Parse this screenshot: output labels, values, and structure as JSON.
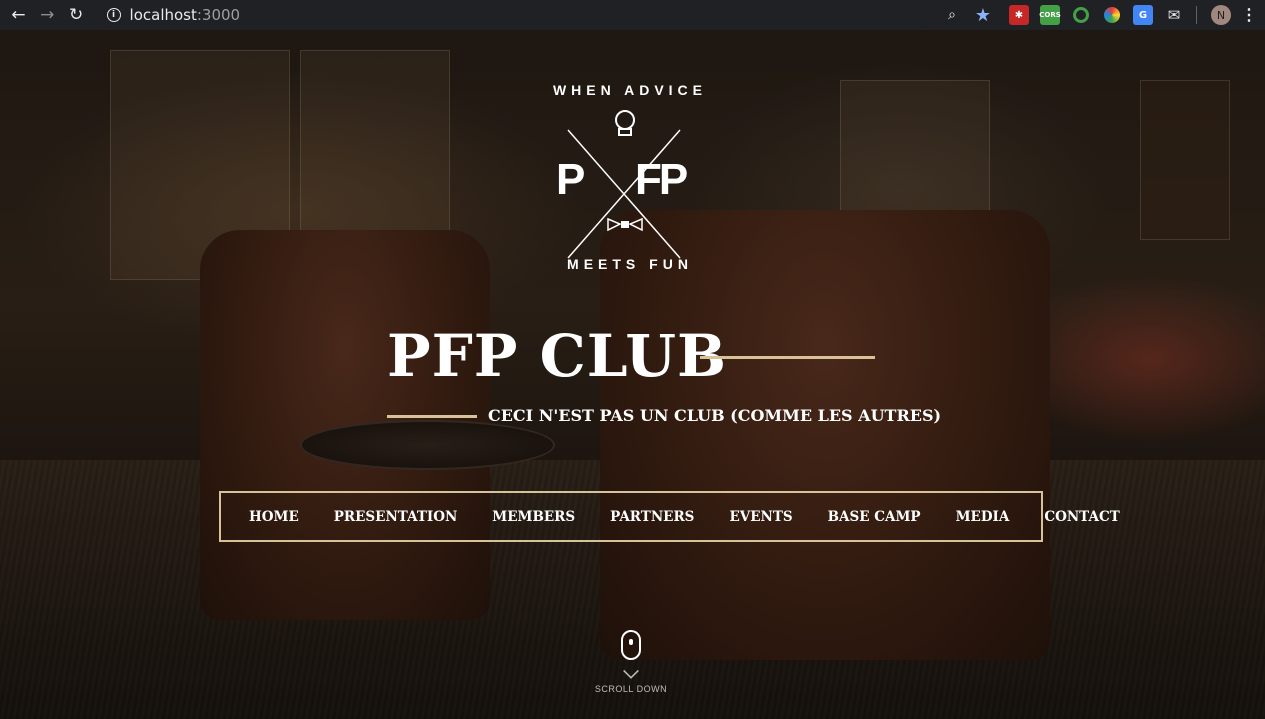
{
  "browser": {
    "url_host": "localhost",
    "url_port": ":3000",
    "avatar_initial": "N",
    "icons": [
      "back-icon",
      "forward-icon",
      "reload-icon",
      "info-icon",
      "zoom-icon",
      "star-icon",
      "menu-icon"
    ],
    "extensions": [
      "ext-red-icon",
      "ext-cors-icon",
      "ext-green-ring-icon",
      "ext-color-icon",
      "ext-translate-icon",
      "ext-mail-icon"
    ],
    "ext_cors_label": "CORS"
  },
  "logo": {
    "top_text": "WHEN ADVICE",
    "bottom_text": "MEETS FUN",
    "monogram_left": "P",
    "monogram_right": "FP"
  },
  "hero": {
    "title": "PFP CLUB",
    "subtitle": "CECI N'EST PAS UN CLUB (COMME LES AUTRES)",
    "accent_color": "#d8c29a"
  },
  "nav": {
    "items": [
      {
        "label": "HOME"
      },
      {
        "label": "PRESENTATION"
      },
      {
        "label": "MEMBERS"
      },
      {
        "label": "PARTNERS"
      },
      {
        "label": "EVENTS"
      },
      {
        "label": "BASE CAMP"
      },
      {
        "label": "MEDIA"
      },
      {
        "label": "CONTACT"
      }
    ]
  },
  "scroll": {
    "label": "SCROLL DOWN"
  }
}
